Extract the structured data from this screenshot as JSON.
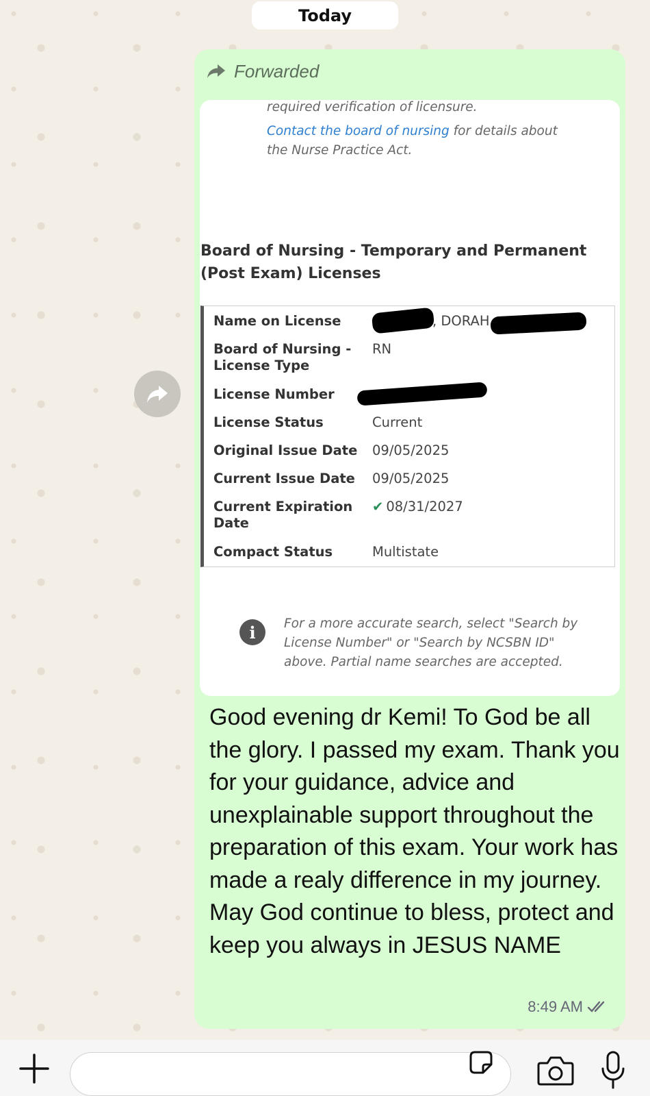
{
  "date_separator": "Today",
  "message": {
    "forwarded_label": "Forwarded",
    "card": {
      "top_note_line1": "required verification of licensure.",
      "link_text": "Contact the board of nursing",
      "link_suffix": " for details about",
      "top_note_line3": "the Nurse Practice Act.",
      "section_title": "Board of Nursing - Temporary and Permanent (Post Exam) Licenses",
      "rows": [
        {
          "label": "Name on License",
          "value": ", DORAH"
        },
        {
          "label": "Board of Nursing - License Type",
          "value": "RN"
        },
        {
          "label": "License Number",
          "value": ""
        },
        {
          "label": "License Status",
          "value": "Current"
        },
        {
          "label": "Original Issue Date",
          "value": "09/05/2025"
        },
        {
          "label": "Current Issue Date",
          "value": "09/05/2025"
        },
        {
          "label": "Current Expiration Date",
          "value": "08/31/2027"
        },
        {
          "label": "Compact Status",
          "value": "Multistate"
        }
      ],
      "info_note": "For a more accurate search, select \"Search by License Number\" or \"Search by NCSBN ID\" above. Partial name searches are accepted."
    },
    "text": "Good evening dr Kemi! To God be all the glory. I passed my exam. Thank you for your guidance, advice and unexplainable support throughout the preparation of this exam. Your work has made a realy difference in my journey. May God continue to bless, protect and keep you always in JESUS NAME",
    "time": "8:49 AM",
    "status": "read"
  },
  "composer": {
    "input_value": ""
  }
}
